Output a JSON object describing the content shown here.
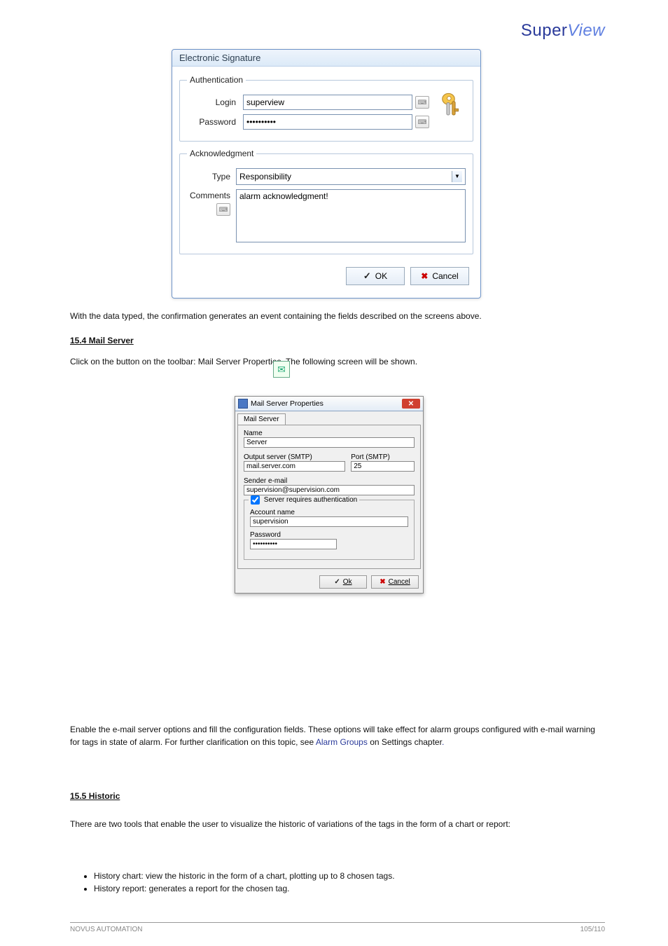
{
  "brand": {
    "name": "SuperView",
    "name_left": "Super",
    "name_right": "View"
  },
  "dialog1": {
    "title": "Electronic Signature",
    "auth": {
      "legend": "Authentication",
      "login_label": "Login",
      "login_value": "superview",
      "password_label": "Password",
      "password_value": "••••••••••"
    },
    "ack": {
      "legend": "Acknowledgment",
      "type_label": "Type",
      "type_value": "Responsibility",
      "comments_label": "Comments",
      "comments_value": "alarm acknowledgment!"
    },
    "ok": "OK",
    "cancel": "Cancel"
  },
  "paragraphs": {
    "p1": "With the data typed, the confirmation generates an event containing the fields described on the screens above.",
    "h2": "15.4 Mail Server",
    "p2a": "Click on the button ",
    "p2b": " on the toolbar: Mail Server Properties. The following screen will be shown.",
    "p3a": "Enable the e-mail server options and fill the configuration fields. These options will take effect for alarm groups configured with e-mail warning for tags in state of alarm. For further clarification on this topic, see ",
    "p3b": "Alarm Groups",
    "p3c": " on Settings chapter",
    "p3d": ".",
    "h3": "15.5 Historic",
    "p4": "There are two tools that enable the user to visualize the historic of variations of the tags in the form of a chart or report:",
    "b1": "History chart: view the historic in the form of a chart, plotting up to 8 chosen tags.",
    "b2": "History report: generates a report for the chosen tag."
  },
  "dialog2": {
    "title": "Mail Server Properties",
    "tab": "Mail Server",
    "name_label": "Name",
    "name_value": "Server",
    "smtp_label": "Output server (SMTP)",
    "smtp_value": "mail.server.com",
    "port_label": "Port (SMTP)",
    "port_value": "25",
    "sender_label": "Sender e-mail",
    "sender_value": "supervision@supervision.com",
    "auth_check": "Server requires authentication",
    "account_label": "Account name",
    "account_value": "supervision",
    "password_label": "Password",
    "password_value": "••••••••••",
    "ok": "Ok",
    "cancel": "Cancel"
  },
  "footer": {
    "left": "NOVUS AUTOMATION",
    "right": "105/110"
  }
}
